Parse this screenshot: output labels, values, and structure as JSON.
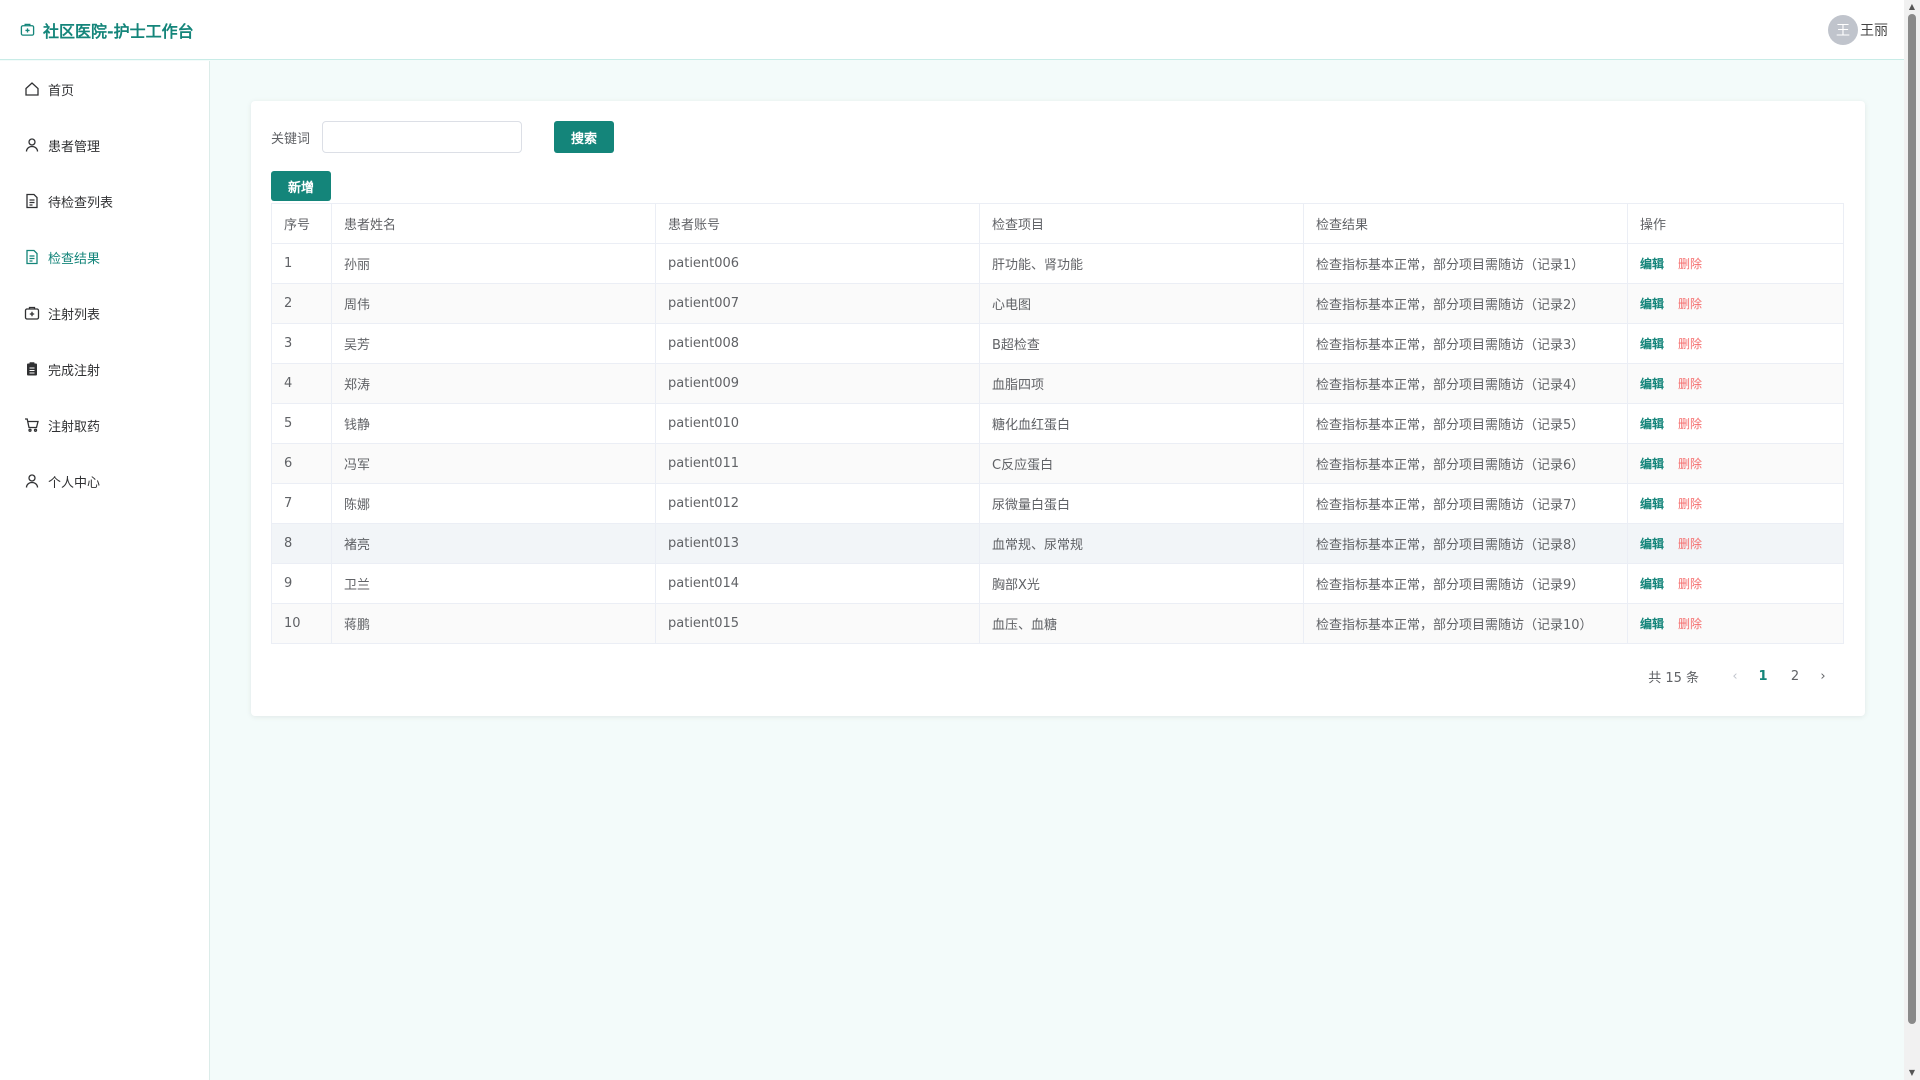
{
  "app": {
    "title": "社区医院-护士工作台"
  },
  "user": {
    "avatar_text": "王",
    "name": "王丽"
  },
  "sidebar": {
    "items": [
      {
        "label": "首页",
        "icon": "home-icon"
      },
      {
        "label": "患者管理",
        "icon": "user-icon"
      },
      {
        "label": "待检查列表",
        "icon": "document-icon"
      },
      {
        "label": "检查结果",
        "icon": "document-icon",
        "active": true
      },
      {
        "label": "注射列表",
        "icon": "first-aid-icon"
      },
      {
        "label": "完成注射",
        "icon": "clipboard-icon"
      },
      {
        "label": "注射取药",
        "icon": "cart-icon"
      },
      {
        "label": "个人中心",
        "icon": "user-icon"
      }
    ]
  },
  "search": {
    "label": "关键词",
    "value": "",
    "placeholder": "",
    "button": "搜索"
  },
  "toolbar": {
    "add_label": "新增"
  },
  "table": {
    "headers": [
      "序号",
      "患者姓名",
      "患者账号",
      "检查项目",
      "检查结果",
      "操作"
    ],
    "edit_label": "编辑",
    "delete_label": "删除",
    "rows": [
      [
        "1",
        "孙丽",
        "patient006",
        "肝功能、肾功能",
        "检查指标基本正常，部分项目需随访（记录1）"
      ],
      [
        "2",
        "周伟",
        "patient007",
        "心电图",
        "检查指标基本正常，部分项目需随访（记录2）"
      ],
      [
        "3",
        "吴芳",
        "patient008",
        "B超检查",
        "检查指标基本正常，部分项目需随访（记录3）"
      ],
      [
        "4",
        "郑涛",
        "patient009",
        "血脂四项",
        "检查指标基本正常，部分项目需随访（记录4）"
      ],
      [
        "5",
        "钱静",
        "patient010",
        "糖化血红蛋白",
        "检查指标基本正常，部分项目需随访（记录5）"
      ],
      [
        "6",
        "冯军",
        "patient011",
        "C反应蛋白",
        "检查指标基本正常，部分项目需随访（记录6）"
      ],
      [
        "7",
        "陈娜",
        "patient012",
        "尿微量白蛋白",
        "检查指标基本正常，部分项目需随访（记录7）"
      ],
      [
        "8",
        "褚亮",
        "patient013",
        "血常规、尿常规",
        "检查指标基本正常，部分项目需随访（记录8）"
      ],
      [
        "9",
        "卫兰",
        "patient014",
        "胸部X光",
        "检查指标基本正常，部分项目需随访（记录9）"
      ],
      [
        "10",
        "蒋鹏",
        "patient015",
        "血压、血糖",
        "检查指标基本正常，部分项目需随访（记录10）"
      ]
    ]
  },
  "pagination": {
    "total_text": "共 15 条",
    "pages": [
      "1",
      "2"
    ],
    "current": "1"
  },
  "colors": {
    "accent": "#14857a",
    "danger": "#f56c6c"
  }
}
